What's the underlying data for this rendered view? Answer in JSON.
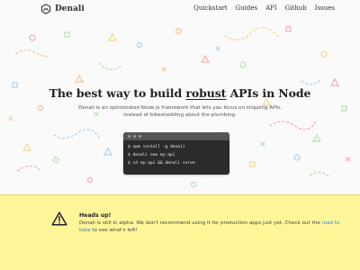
{
  "header": {
    "logo_text": "Denali",
    "nav": [
      "Quickstart",
      "Guides",
      "API",
      "Github",
      "Issues"
    ]
  },
  "hero": {
    "title_before": "The best way to build ",
    "title_emphasis": "robust",
    "title_after": " APIs in Node",
    "subtitle": "Denali is an opinionated Node.js framework that lets you focus on shipping APIs, instead of bikeshedding about the plumbing."
  },
  "terminal": {
    "lines": [
      "$ npm install -g denali",
      "$ denali new my-api",
      "$ cd my-api && denali serve"
    ]
  },
  "banner": {
    "title": "Heads up!",
    "body_before": "Denali is still in alpha. We don't recommend using it for production apps just yet. Check out the ",
    "link_text": "road to beta",
    "body_after": " to see what's left!",
    "background": "#fff69a"
  },
  "colors": {
    "link": "#2a8ad8",
    "terminal": "#2b2b2b"
  },
  "icons": {
    "logo": "hexagon-mountain-icon",
    "banner": "warning-triangle-icon"
  }
}
